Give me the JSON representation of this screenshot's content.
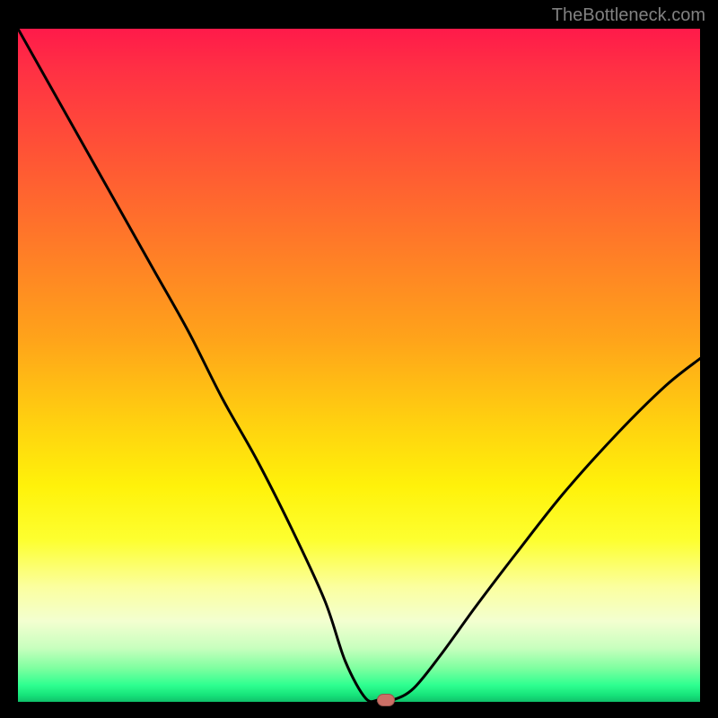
{
  "attribution": "TheBottleneck.com",
  "chart_data": {
    "type": "line",
    "title": "",
    "xlabel": "",
    "ylabel": "",
    "xlim": [
      0,
      100
    ],
    "ylim": [
      0,
      100
    ],
    "series": [
      {
        "name": "bottleneck-curve",
        "x": [
          0,
          5,
          10,
          15,
          20,
          25,
          30,
          35,
          40,
          45,
          48,
          51,
          53,
          55,
          58,
          62,
          67,
          73,
          80,
          88,
          95,
          100
        ],
        "y": [
          100,
          91,
          82,
          73,
          64,
          55,
          45,
          36,
          26,
          15,
          6,
          0.5,
          0.3,
          0.3,
          2,
          7,
          14,
          22,
          31,
          40,
          47,
          51
        ]
      }
    ],
    "marker": {
      "x": 54,
      "y": 0.3,
      "color": "#cc6f66"
    },
    "gradient_stops": [
      {
        "p": 0,
        "c": "#ff1a4a"
      },
      {
        "p": 50,
        "c": "#ffcf10"
      },
      {
        "p": 80,
        "c": "#fbffa0"
      },
      {
        "p": 100,
        "c": "#10c06a"
      }
    ]
  }
}
